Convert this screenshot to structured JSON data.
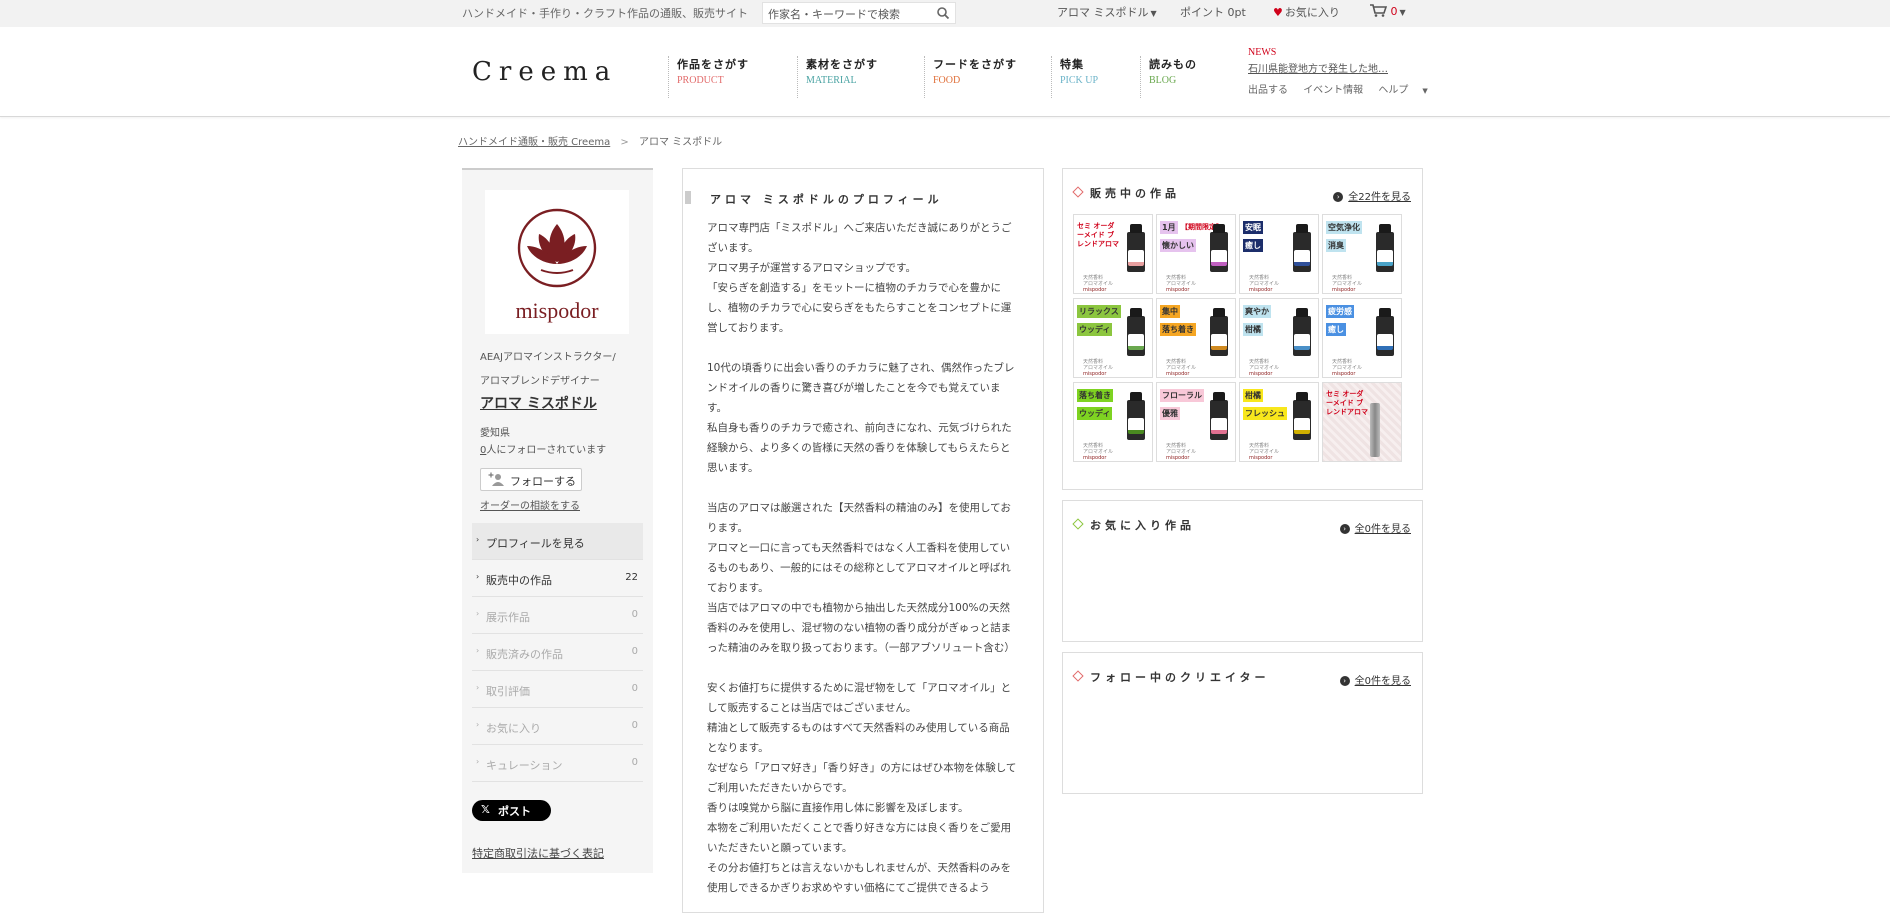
{
  "topbar": {
    "tagline": "ハンドメイド・手作り・クラフト作品の通販、販売サイト",
    "search_placeholder": "作家名・キーワードで検索",
    "user_menu": "アロマ ミスポドル",
    "points_label": "ポイント",
    "points_value": "0pt",
    "favorites": "お気に入り",
    "cart_count": "0"
  },
  "header": {
    "logo": "Creema",
    "nav": [
      {
        "jp": "作品をさがす",
        "en": "PRODUCT",
        "color": "#e26b6b"
      },
      {
        "jp": "素材をさがす",
        "en": "MATERIAL",
        "color": "#4aa3a3"
      },
      {
        "jp": "フードをさがす",
        "en": "FOOD",
        "color": "#e0703a"
      },
      {
        "jp": "特集",
        "en": "PICK UP",
        "color": "#6bb3c8"
      },
      {
        "jp": "読みもの",
        "en": "BLOG",
        "color": "#6aa84f"
      }
    ],
    "news_label": "NEWS",
    "news_text": "石川県能登地方で発生した地…",
    "subnav": [
      "出品する",
      "イベント情報",
      "ヘルプ"
    ]
  },
  "breadcrumb": {
    "home": "ハンドメイド通販・販売 Creema",
    "current": "アロマ ミスポドル"
  },
  "sidebar": {
    "avatar_text": "mispodor",
    "role_line1": "AEAJアロマインストラクター/",
    "role_line2": "アロマブレンドデザイナー",
    "shop_name": "アロマ ミスポドル",
    "prefecture": "愛知県",
    "follower_count": "0",
    "follower_suffix": "人にフォローされています",
    "follow_button": "フォローする",
    "order_link": "オーダーの相談をする",
    "menu": [
      {
        "label": "プロフィールを見る",
        "count": ""
      },
      {
        "label": "販売中の作品",
        "count": "22"
      },
      {
        "label": "展示作品",
        "count": "0"
      },
      {
        "label": "販売済みの作品",
        "count": "0"
      },
      {
        "label": "取引評価",
        "count": "0"
      },
      {
        "label": "お気に入り",
        "count": "0"
      },
      {
        "label": "キュレーション",
        "count": "0"
      }
    ],
    "post_button": "ポスト",
    "law_link": "特定商取引法に基づく表記"
  },
  "profile": {
    "title": "アロマ ミスポドルのプロフィール",
    "paragraphs": [
      [
        "アロマ専門店「ミスポドル」へご来店いただき誠にありがとうございます。",
        "アロマ男子が運営するアロマショップです。",
        "「安らぎを創造する」をモットーに植物のチカラで心を豊かにし、植物のチカラで心に安らぎをもたらすことをコンセプトに運営しております。"
      ],
      [
        "10代の頃香りに出会い香りのチカラに魅了され、偶然作ったブレンドオイルの香りに驚き喜びが増したことを今でも覚えています。",
        "私自身も香りのチカラで癒され、前向きになれ、元気づけられた経験から、より多くの皆様に天然の香りを体験してもらえたらと思います。"
      ],
      [
        "当店のアロマは厳選された【天然香料の精油のみ】を使用しております。",
        "アロマと一口に言っても天然香料ではなく人工香料を使用しているものもあり、一般的にはその総称としてアロマオイルと呼ばれております。",
        "当店ではアロマの中でも植物から抽出した天然成分100%の天然香料のみを使用し、混ぜ物のない植物の香り成分がぎゅっと詰まった精油のみを取り扱っております。（一部アブソリュート含む）"
      ],
      [
        "安くお値打ちに提供するために混ぜ物をして「アロマオイル」として販売することは当店ではございません。",
        "精油として販売するものはすべて天然香料のみ使用している商品となります。",
        "なぜなら「アロマ好き」「香り好き」の方にはぜひ本物を体験してご利用いただきたいからです。",
        "香りは嗅覚から脳に直接作用し体に影響を及ぼします。",
        "本物をご利用いただくことで香り好きな方には良く香りをご愛用いただきたいと願っています。",
        "その分お値打ちとは言えないかもしれませんが、天然香料のみを使用しできるかぎりお求めやすい価格にてご提供できるよう"
      ]
    ]
  },
  "on_sale": {
    "title": "販売中の作品",
    "see_all": "全22件を見る",
    "diamond_color": "#e26b6b",
    "tiles": [
      {
        "tag": "セミ オーダーメイド ブレンドアロマ",
        "tag_bg": "",
        "tag_color": "#d0021b",
        "label_color": "#e8a0a0"
      },
      {
        "tag": "1月",
        "extra": "【期間限定】",
        "sub": "懐かしい",
        "tag_bg": "#e6c3ee",
        "label_color": "#c060c0"
      },
      {
        "tag": "安眠",
        "sub": "癒し",
        "tag_bg": "#1c2e6b",
        "tag_color": "#fff",
        "label_color": "#30509a"
      },
      {
        "tag": "空気浄化",
        "sub": "消臭",
        "tag_bg": "#bfe3ef",
        "label_color": "#4aa3c8"
      },
      {
        "tag": "リラックス",
        "sub": "ウッディ",
        "tag_bg": "#8cc63f",
        "label_color": "#6aa84f"
      },
      {
        "tag": "集中",
        "sub": "落ち着き",
        "tag_bg": "#f5a623",
        "label_color": "#d08a20"
      },
      {
        "tag": "爽やか",
        "sub": "柑橘",
        "tag_bg": "#bfe3ef",
        "label_color": "#4a90c8"
      },
      {
        "tag": "疲労感",
        "sub": "癒し",
        "tag_bg": "#4a90e2",
        "tag_color": "#fff",
        "label_color": "#3070b8"
      },
      {
        "tag": "落ち着き",
        "sub": "ウッディ",
        "tag_bg": "#7ed321",
        "label_color": "#4a8a20"
      },
      {
        "tag": "フローラル",
        "sub": "優雅",
        "tag_bg": "#f8c8d8",
        "label_color": "#e07090"
      },
      {
        "tag": "柑橘",
        "sub": "フレッシュ",
        "tag_bg": "#f8e71c",
        "label_color": "#d0b000"
      },
      {
        "tag": "セミ オーダーメイド ブレンドアロマ",
        "special": true,
        "tag_color": "#d0021b"
      }
    ],
    "brand_line1": "天然香料",
    "brand_line2": "アロマオイル",
    "brand_name": "mispodor"
  },
  "favorites_panel": {
    "title": "お気に入り作品",
    "see_all": "全0件を見る",
    "diamond_color": "#8cc63f"
  },
  "following_panel": {
    "title": "フォロー中のクリエイター",
    "see_all": "全0件を見る",
    "diamond_color": "#e26b6b"
  }
}
